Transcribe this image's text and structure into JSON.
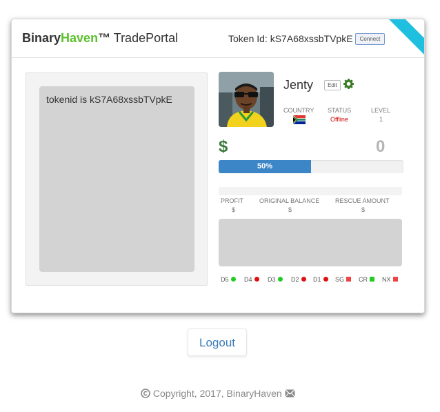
{
  "header": {
    "brand_binary": "Binary",
    "brand_haven": "Haven",
    "brand_tm": "™",
    "brand_portal": " TradePortal",
    "token_label": "Token Id:",
    "token_value": "kS7A68xssbTVpkE",
    "connect_label": "Connect"
  },
  "left_panel": {
    "tokenid_text": "tokenid is kS7A68xssbTVpkE"
  },
  "profile": {
    "username": "Jenty",
    "edit_label": "Edit",
    "country_label": "COUNTRY",
    "status_label": "STATUS",
    "status_value": "Offline",
    "level_label": "LEVEL",
    "level_value": "1",
    "balance_symbol": "$",
    "balance_value": "0",
    "progress_label": "50%",
    "progress_fraction": 0.5
  },
  "columns": {
    "profit_label": "PROFIT",
    "profit_value": "$",
    "original_label": "ORIGINAL BALANCE",
    "original_value": "$",
    "rescue_label": "RESCUE AMOUNT",
    "rescue_value": "$"
  },
  "indicators": [
    {
      "label": "D5",
      "shape": "dot",
      "color": "#22cc22"
    },
    {
      "label": "D4",
      "shape": "dot",
      "color": "#dd1111"
    },
    {
      "label": "D3",
      "shape": "dot",
      "color": "#22cc22"
    },
    {
      "label": "D2",
      "shape": "dot",
      "color": "#dd1111"
    },
    {
      "label": "D1",
      "shape": "dot",
      "color": "#dd1111"
    },
    {
      "label": "SG",
      "shape": "square",
      "color": "#ee4444"
    },
    {
      "label": "CR",
      "shape": "square",
      "color": "#22cc22"
    },
    {
      "label": "NX",
      "shape": "square",
      "color": "#ee4444"
    }
  ],
  "logout_label": "Logout",
  "footer": {
    "copyright_text": "Copyright, 2017, BinaryHaven"
  },
  "colors": {
    "brand_green": "#5ac12b",
    "progress_blue": "#3c86c8",
    "ribbon_cyan": "#1ebfdf",
    "status_offline": "#cc0000"
  },
  "icons": {
    "gear": "gear-icon",
    "copyright": "copyright-icon",
    "mail": "envelope-icon",
    "flag": "south-africa-flag-icon"
  }
}
